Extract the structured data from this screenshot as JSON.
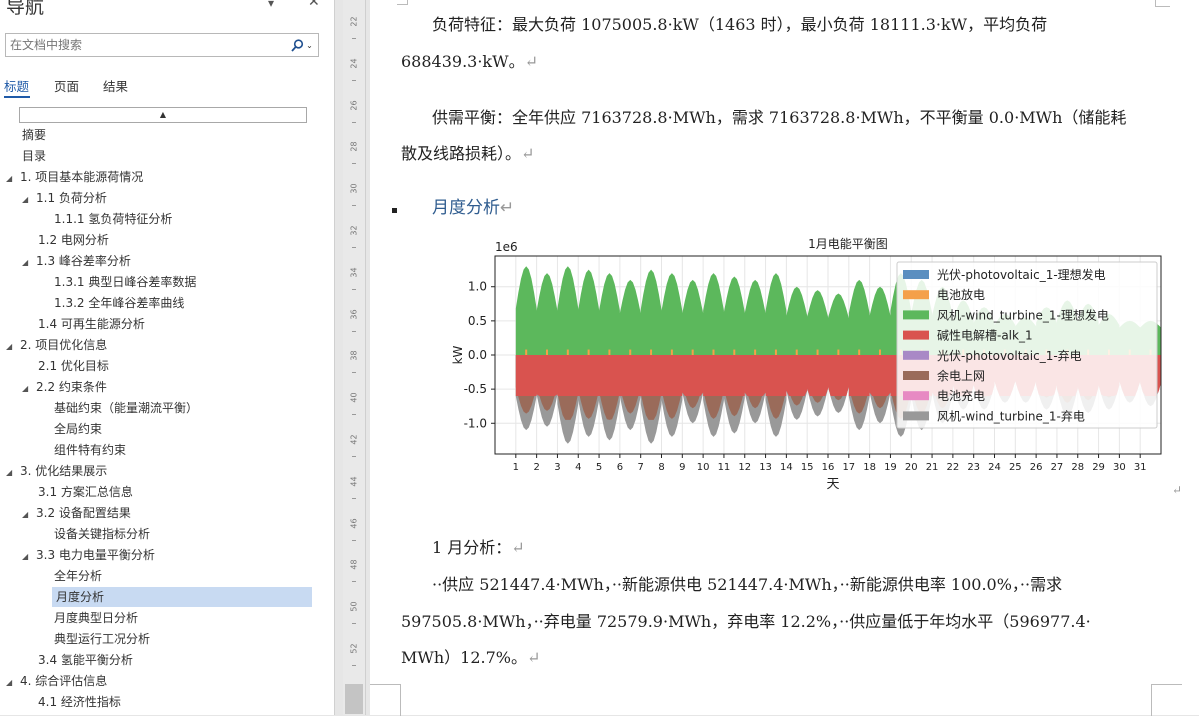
{
  "nav": {
    "title": "导航",
    "search_placeholder": "在文档中搜索",
    "tabs": [
      "标题",
      "页面",
      "结果"
    ],
    "items": [
      {
        "label": "摘要",
        "level": 0
      },
      {
        "label": "目录",
        "level": 0
      },
      {
        "label": "1. 项目基本能源荷情况",
        "level": 0,
        "expand": true
      },
      {
        "label": "1.1 负荷分析",
        "level": 1,
        "expand": true
      },
      {
        "label": "1.1.1 氢负荷特征分析",
        "level": 2
      },
      {
        "label": "1.2 电网分析",
        "level": 1
      },
      {
        "label": "1.3 峰谷差率分析",
        "level": 1,
        "expand": true
      },
      {
        "label": "1.3.1 典型日峰谷差率数据",
        "level": 2
      },
      {
        "label": "1.3.2 全年峰谷差率曲线",
        "level": 2
      },
      {
        "label": "1.4 可再生能源分析",
        "level": 1
      },
      {
        "label": "2. 项目优化信息",
        "level": 0,
        "expand": true
      },
      {
        "label": "2.1 优化目标",
        "level": 1
      },
      {
        "label": "2.2 约束条件",
        "level": 1,
        "expand": true
      },
      {
        "label": "基础约束（能量潮流平衡）",
        "level": 2
      },
      {
        "label": "全局约束",
        "level": 2
      },
      {
        "label": "组件特有约束",
        "level": 2
      },
      {
        "label": "3. 优化结果展示",
        "level": 0,
        "expand": true
      },
      {
        "label": "3.1 方案汇总信息",
        "level": 1
      },
      {
        "label": "3.2 设备配置结果",
        "level": 1,
        "expand": true
      },
      {
        "label": "设备关键指标分析",
        "level": 2
      },
      {
        "label": "3.3 电力电量平衡分析",
        "level": 1,
        "expand": true
      },
      {
        "label": "全年分析",
        "level": 2
      },
      {
        "label": "月度分析",
        "level": 2,
        "selected": true
      },
      {
        "label": "月度典型日分析",
        "level": 2
      },
      {
        "label": "典型运行工况分析",
        "level": 2
      },
      {
        "label": "3.4 氢能平衡分析",
        "level": 1
      },
      {
        "label": "4. 综合评估信息",
        "level": 0,
        "expand": true
      },
      {
        "label": "4.1 经济性指标",
        "level": 1
      }
    ]
  },
  "ruler": [
    "22",
    "24",
    "26",
    "28",
    "30",
    "32",
    "34",
    "36",
    "38",
    "40",
    "42",
    "44",
    "46",
    "48",
    "50",
    "52"
  ],
  "doc": {
    "p1_line1": "负荷特征：最大负荷 1075005.8·kW（1463 时），最小负荷 18111.3·kW，平均负荷",
    "p1_line2": "688439.3·kW。",
    "p2_line1": "供需平衡：全年供应 7163728.8·MWh，需求 7163728.8·MWh，不平衡量 0.0·MWh（储能耗",
    "p2_line2": "散及线路损耗）。",
    "heading": "月度分析",
    "p3": "1 月分析：",
    "p4_line1": "··供应 521447.4·MWh，··新能源供电 521447.4·MWh，··新能源供电率 100.0%，··需求",
    "p4_line2": "597505.8·MWh，··弃电量 72579.9·MWh，弃电率 12.2%，··供应量低于年均水平（596977.4·",
    "p4_line3": "MWh）12.7%。",
    "return_mark": "↵"
  },
  "chart_data": {
    "type": "area",
    "title": "1月电能平衡图",
    "xlabel": "天",
    "ylabel": "kW",
    "y_multiplier_label": "1e6",
    "x_ticks": [
      "1",
      "2",
      "3",
      "4",
      "5",
      "6",
      "7",
      "8",
      "9",
      "10",
      "11",
      "12",
      "13",
      "14",
      "15",
      "16",
      "17",
      "18",
      "19",
      "20",
      "21",
      "22",
      "23",
      "24",
      "25",
      "26",
      "27",
      "28",
      "29",
      "30",
      "31"
    ],
    "y_ticks": [
      1.0,
      0.5,
      0.0,
      -0.5,
      -1.0
    ],
    "ylim": [
      -1.45,
      1.45
    ],
    "xlim": [
      0,
      32
    ],
    "legend_position": "top-right",
    "series": [
      {
        "name": "光伏-photovoltaic_1-理想发电",
        "color": "#5b8fc0"
      },
      {
        "name": "电池放电",
        "color": "#f4a04a"
      },
      {
        "name": "风机-wind_turbine_1-理想发电",
        "color": "#5cb85c"
      },
      {
        "name": "碱性电解槽-alk_1",
        "color": "#d9534f"
      },
      {
        "name": "光伏-photovoltaic_1-弃电",
        "color": "#a989c6"
      },
      {
        "name": "余电上网",
        "color": "#9a6b5a"
      },
      {
        "name": "电池充电",
        "color": "#e78ac3"
      },
      {
        "name": "风机-wind_turbine_1-弃电",
        "color": "#999999"
      }
    ],
    "approx_daily_wind_peak_e6": [
      1.3,
      1.2,
      1.3,
      1.25,
      1.2,
      1.1,
      1.25,
      1.2,
      1.1,
      1.2,
      1.15,
      1.1,
      1.2,
      1.0,
      0.95,
      0.9,
      1.1,
      1.0,
      1.2,
      1.1,
      1.0,
      0.8,
      0.7,
      0.6,
      0.55,
      0.7,
      0.8,
      0.75,
      0.6,
      0.5,
      0.5
    ],
    "approx_electrolyzer_e6": -0.6,
    "approx_daily_negative_peak_e6": [
      -1.1,
      -1.05,
      -1.3,
      -1.2,
      -1.25,
      -1.1,
      -1.3,
      -1.2,
      -1.0,
      -1.2,
      -1.15,
      -1.0,
      -1.2,
      -0.95,
      -0.9,
      -0.85,
      -1.1,
      -1.0,
      -1.2,
      -1.1,
      -1.0,
      -0.8,
      -0.8,
      -0.7,
      -0.7,
      -0.8,
      -0.9,
      -0.85,
      -0.8,
      -0.7,
      -0.75
    ]
  }
}
